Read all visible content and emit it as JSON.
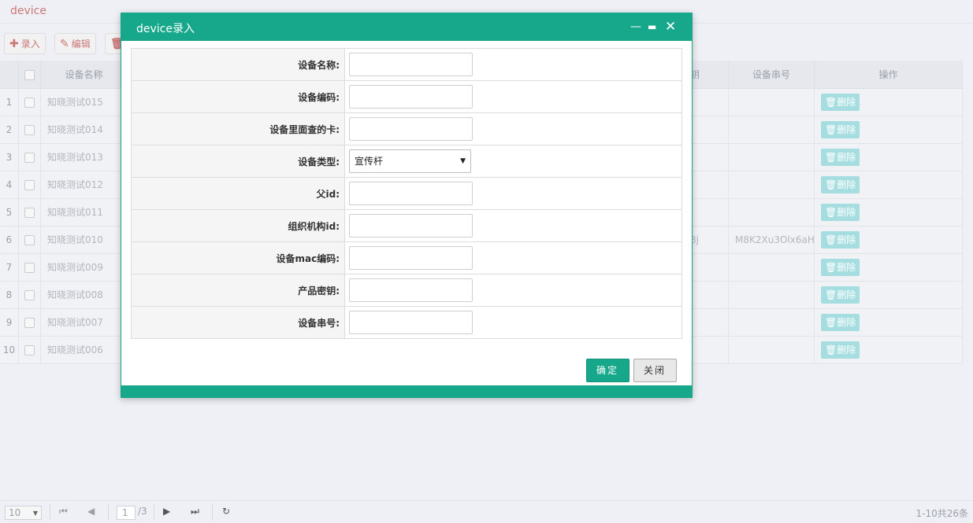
{
  "page": {
    "title": "device"
  },
  "toolbar": {
    "add_label": "录入",
    "edit_label": "编辑"
  },
  "grid": {
    "headers": {
      "name": "设备名称",
      "key": "钥",
      "serial": "设备串号",
      "op": "操作"
    },
    "rows": [
      {
        "n": "1",
        "name": "知晓测试015",
        "key": "",
        "serial": ""
      },
      {
        "n": "2",
        "name": "知晓测试014",
        "key": "",
        "serial": ""
      },
      {
        "n": "3",
        "name": "知晓测试013",
        "key": "",
        "serial": ""
      },
      {
        "n": "4",
        "name": "知晓测试012",
        "key": "",
        "serial": ""
      },
      {
        "n": "5",
        "name": "知晓测试011",
        "key": "",
        "serial": ""
      },
      {
        "n": "6",
        "name": "知晓测试010",
        "key": "8j",
        "serial": "M8K2Xu3Olx6aH"
      },
      {
        "n": "7",
        "name": "知晓测试009",
        "key": "",
        "serial": ""
      },
      {
        "n": "8",
        "name": "知晓测试008",
        "key": "",
        "serial": ""
      },
      {
        "n": "9",
        "name": "知晓测试007",
        "key": "",
        "serial": ""
      },
      {
        "n": "10",
        "name": "知晓测试006",
        "key": "",
        "serial": ""
      }
    ],
    "delete_label": "删除"
  },
  "pager": {
    "page_size": "10",
    "current_page": "1",
    "total_pages": "/3",
    "info": "1-10共26条"
  },
  "modal": {
    "title": "device录入",
    "fields": [
      {
        "label": "设备名称:"
      },
      {
        "label": "设备编码:"
      },
      {
        "label": "设备里面查的卡:"
      },
      {
        "label": "设备类型:",
        "value": "宣传杆"
      },
      {
        "label": "父id:"
      },
      {
        "label": "组织机构id:"
      },
      {
        "label": "设备mac编码:"
      },
      {
        "label": "产品密钥:"
      },
      {
        "label": "设备串号:"
      }
    ],
    "confirm_label": "确定",
    "close_label": "关闭"
  },
  "colors": {
    "accent": "#17a88b",
    "delete": "#a6dde0"
  }
}
